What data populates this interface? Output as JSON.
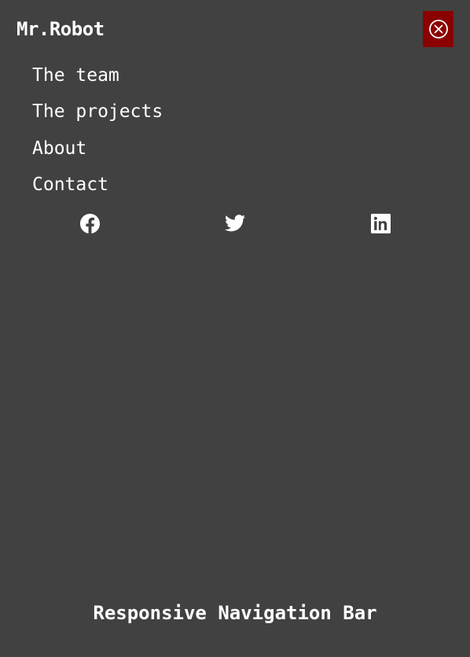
{
  "brand": {
    "name": "Mr.Robot"
  },
  "close_button": {
    "icon": "close-circle-icon",
    "color": "#8b0000"
  },
  "menu": {
    "items": [
      {
        "label": "The team"
      },
      {
        "label": "The projects"
      },
      {
        "label": "About"
      },
      {
        "label": "Contact"
      }
    ]
  },
  "social": [
    {
      "icon": "facebook-icon"
    },
    {
      "icon": "twitter-icon"
    },
    {
      "icon": "linkedin-icon"
    }
  ],
  "footer": {
    "title": "Responsive Navigation Bar"
  },
  "theme": {
    "background": "#414141",
    "text": "#ffffff",
    "accent": "#8b0000"
  }
}
